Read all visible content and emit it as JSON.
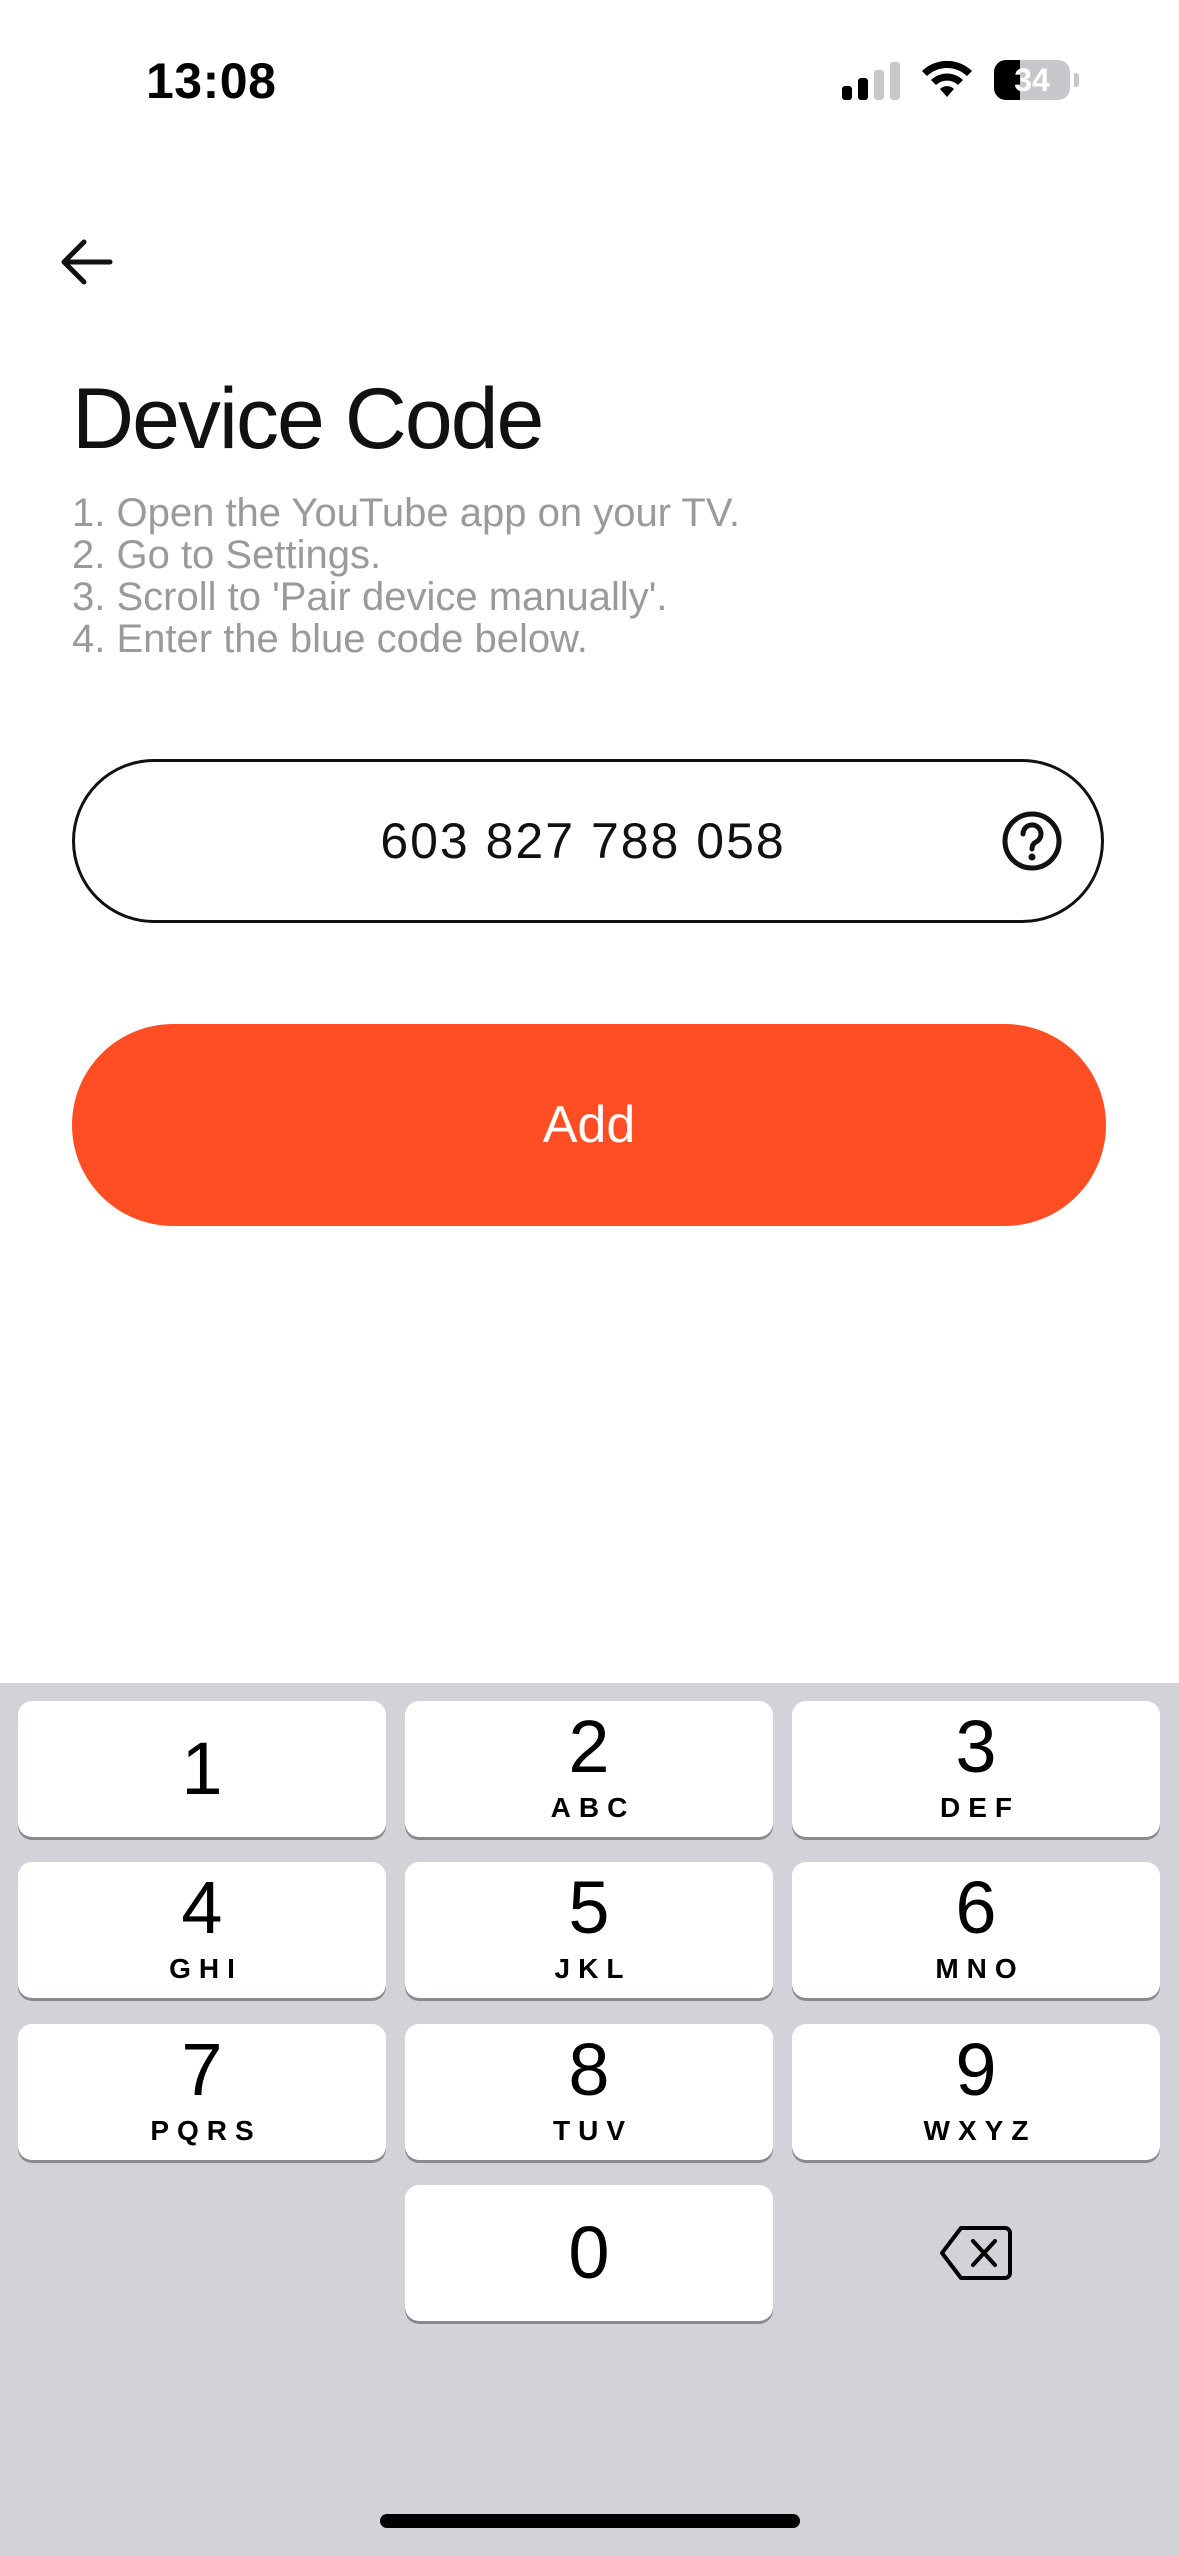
{
  "status_bar": {
    "time": "13:08",
    "battery_percent": "34",
    "battery_level": 0.34,
    "signal_bars_active": 2,
    "signal_bars_total": 4
  },
  "header": {
    "back_icon": "arrow-left-icon",
    "title": "Device Code"
  },
  "instructions": [
    "1. Open the YouTube app on your TV.",
    "2. Go to Settings.",
    "3. Scroll to 'Pair device manually'.",
    "4. Enter the blue code below."
  ],
  "code_field": {
    "value": "603 827 788 058",
    "help_icon": "question-circle-icon"
  },
  "add_button": {
    "label": "Add",
    "color": "#ff4e24"
  },
  "keyboard": {
    "keys": [
      {
        "num": "1",
        "letters": ""
      },
      {
        "num": "2",
        "letters": "ABC"
      },
      {
        "num": "3",
        "letters": "DEF"
      },
      {
        "num": "4",
        "letters": "GHI"
      },
      {
        "num": "5",
        "letters": "JKL"
      },
      {
        "num": "6",
        "letters": "MNO"
      },
      {
        "num": "7",
        "letters": "PQRS"
      },
      {
        "num": "8",
        "letters": "TUV"
      },
      {
        "num": "9",
        "letters": "WXYZ"
      },
      {
        "num": "0",
        "letters": ""
      }
    ],
    "delete_icon": "backspace-icon"
  }
}
